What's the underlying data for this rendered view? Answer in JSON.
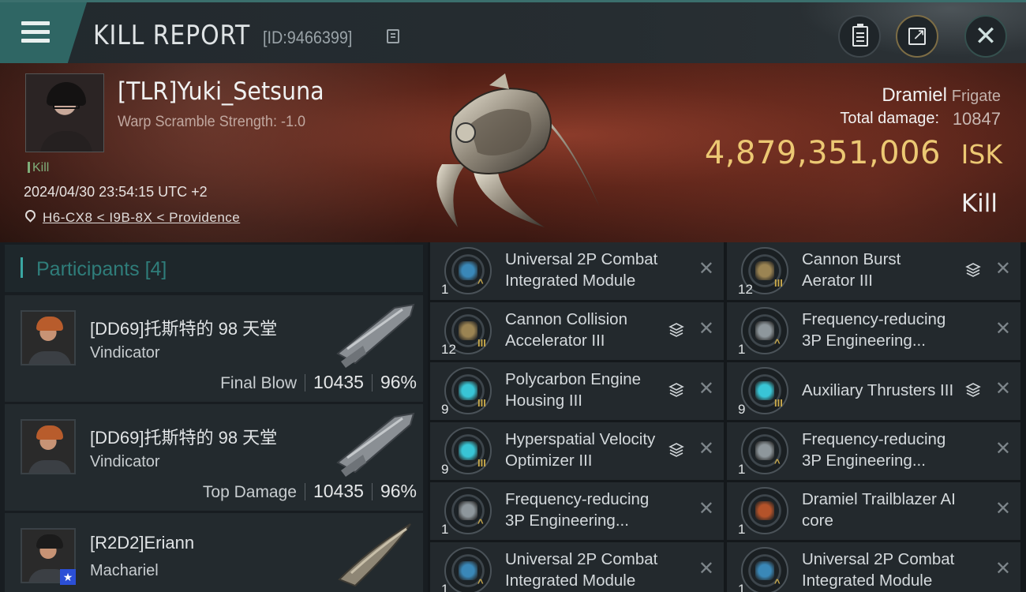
{
  "header": {
    "title": "KILL REPORT",
    "id_text": "[ID:9466399]"
  },
  "victim": {
    "name": "[TLR]Yuki_Setsuna",
    "subtitle": "Warp Scramble Strength: -1.0",
    "tag": "Kill",
    "datetime": "2024/04/30 23:54:15 UTC +2",
    "location": "H6-CX8 < I9B-8X < Providence",
    "ship": "Dramiel",
    "ship_class": "Frigate",
    "total_damage_label": "Total damage:",
    "total_damage": "10847",
    "isk_value": "4,879,351,006",
    "isk_unit": "ISK",
    "result": "Kill"
  },
  "participants": {
    "header": "Participants",
    "count": "[4]",
    "rows": [
      {
        "name": "[DD69]托斯特的 98 天堂",
        "ship": "Vindicator",
        "role": "Final Blow",
        "damage": "10435",
        "percent": "96%"
      },
      {
        "name": "[DD69]托斯特的 98 天堂",
        "ship": "Vindicator",
        "role": "Top Damage",
        "damage": "10435",
        "percent": "96%"
      },
      {
        "name": "[R2D2]Eriann",
        "ship": "Machariel"
      }
    ]
  },
  "items": [
    {
      "qty": "1",
      "name1": "Universal 2P Combat",
      "name2": "Integrated Module",
      "icon": "combat-module-icon",
      "color": "#3a88b8",
      "stack": false,
      "meta": "^"
    },
    {
      "qty": "12",
      "name1": "Cannon Burst",
      "name2": "Aerator III",
      "icon": "cannon-upgrade-icon",
      "color": "#9b8453",
      "stack": true,
      "meta": "III"
    },
    {
      "qty": "12",
      "name1": "Cannon Collision",
      "name2": "Accelerator III",
      "icon": "cannon-upgrade-icon",
      "color": "#9b8453",
      "stack": true,
      "meta": "III"
    },
    {
      "qty": "1",
      "name1": "Frequency-reducing",
      "name2": "3P Engineering...",
      "icon": "engineering-module-icon",
      "color": "#8e979c",
      "stack": false,
      "meta": "^"
    },
    {
      "qty": "9",
      "name1": "Polycarbon Engine",
      "name2": "Housing III",
      "icon": "engine-rig-icon",
      "color": "#39c5d6",
      "stack": true,
      "meta": "III"
    },
    {
      "qty": "9",
      "name1": "Auxiliary Thrusters III",
      "name2": "",
      "icon": "engine-rig-icon",
      "color": "#39c5d6",
      "stack": true,
      "meta": "III"
    },
    {
      "qty": "9",
      "name1": "Hyperspatial Velocity",
      "name2": "Optimizer III",
      "icon": "engine-rig-icon",
      "color": "#39c5d6",
      "stack": true,
      "meta": "III"
    },
    {
      "qty": "1",
      "name1": "Frequency-reducing",
      "name2": "3P Engineering...",
      "icon": "engineering-module-icon",
      "color": "#8e979c",
      "stack": false,
      "meta": "^"
    },
    {
      "qty": "1",
      "name1": "Frequency-reducing",
      "name2": "3P Engineering...",
      "icon": "engineering-module-icon",
      "color": "#8e979c",
      "stack": false,
      "meta": "^"
    },
    {
      "qty": "1",
      "name1": "Dramiel Trailblazer AI",
      "name2": "core",
      "icon": "ai-core-icon",
      "color": "#b4532a",
      "stack": false,
      "meta": ""
    },
    {
      "qty": "1",
      "name1": "Universal 2P Combat",
      "name2": "Integrated Module",
      "icon": "combat-module-icon",
      "color": "#3a88b8",
      "stack": false,
      "meta": "^"
    },
    {
      "qty": "1",
      "name1": "Universal 2P Combat",
      "name2": "Integrated Module",
      "icon": "combat-module-icon",
      "color": "#3a88b8",
      "stack": false,
      "meta": "^"
    }
  ],
  "colors": {
    "accent": "#2f6664",
    "isk": "#ecc873",
    "banner": "#5a2318"
  }
}
